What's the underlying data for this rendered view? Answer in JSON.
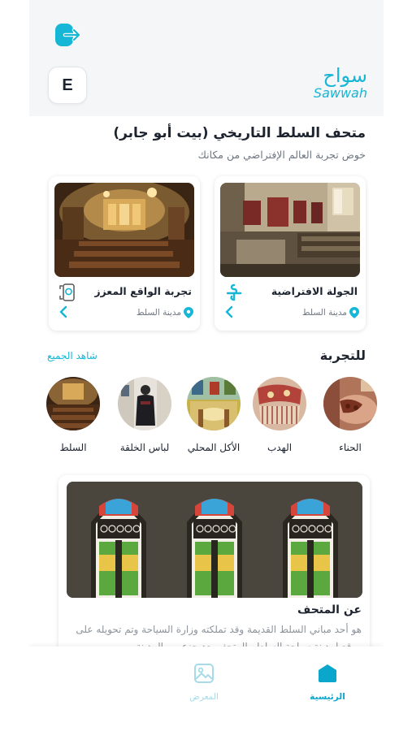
{
  "header": {
    "avatar_letter": "E",
    "logo_ar": "سواح",
    "logo_en": "Sawwah"
  },
  "page": {
    "title": "متحف السلط التاريخي (بيت أبو جابر)",
    "subtitle": "خوض تجربة العالم الإفتراضي من مكانك"
  },
  "cards": [
    {
      "title": "الجولة الافتراضية",
      "location": "مدينة السلط",
      "icon": "virtual-tour-icon"
    },
    {
      "title": "تجربة الواقع المعزز",
      "location": "مدينة السلط",
      "icon": "augmented-reality-icon"
    }
  ],
  "experience": {
    "title": "للتجربة",
    "see_all": "شاهد الجميع",
    "items": [
      {
        "label": "الحناء"
      },
      {
        "label": "الهدب"
      },
      {
        "label": "الأكل المحلي"
      },
      {
        "label": "لباس الخلقة"
      },
      {
        "label": "السلط"
      }
    ]
  },
  "about": {
    "title": "عن المتحف",
    "text": "هو أحد مباني السلط القديمة وقد تملكته وزارة السياحة وتم تحويله على موقع لمدينة سياحة السلط والمتحف يعد جزء من المدينة"
  },
  "nav": {
    "home": "الرئيسية",
    "gallery": "المعرض"
  },
  "colors": {
    "accent": "#16b6d6",
    "active": "#0aa6cc",
    "inactive": "#a7dbe8"
  }
}
